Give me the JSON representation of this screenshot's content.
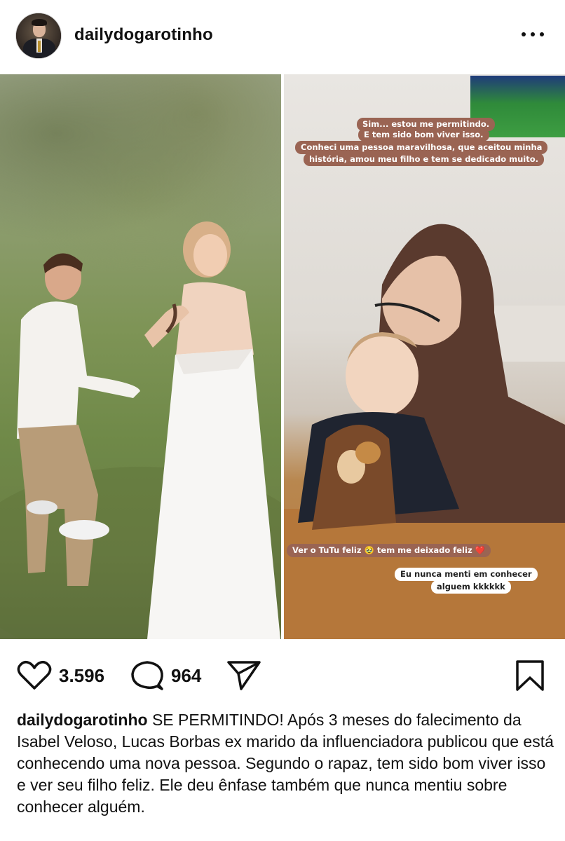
{
  "post": {
    "username": "dailydogarotinho",
    "likes": "3.596",
    "comments": "964",
    "caption_user": "dailydogarotinho",
    "caption_text": "SE PERMITINDO! Após 3 meses do falecimento da Isabel Veloso, Lucas Borbas ex marido da influenciadora publicou que está conhecendo uma nova pessoa. Segundo o rapaz, tem sido bom viver isso e ver seu filho feliz. Ele deu ênfase também que nunca mentiu sobre conhecer alguém."
  },
  "story": {
    "line1": "Sim... estou me permitindo.",
    "line2": "E tem sido bom viver isso.",
    "line3": "Conheci uma pessoa maravilhosa, que aceitou minha",
    "line4": "história, amou meu filho e tem se dedicado muito.",
    "line5": "Ver o TuTu feliz 🥹 tem me deixado feliz ❤️",
    "line6": "Eu nunca menti em conhecer",
    "line7": "alguem kkkkkk"
  },
  "icons": {
    "like": "heart-icon",
    "comment": "comment-icon",
    "share": "send-icon",
    "save": "bookmark-icon",
    "more": "more-icon"
  },
  "colors": {
    "story_bubble": "#9a6453",
    "text": "#111111"
  }
}
